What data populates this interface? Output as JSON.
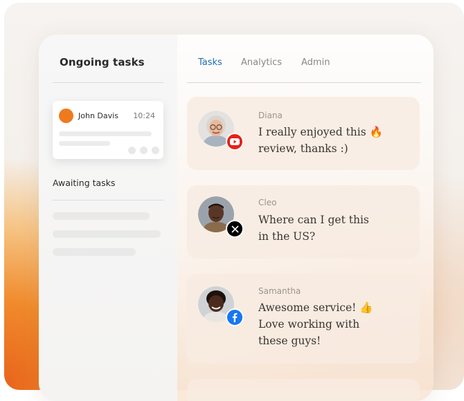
{
  "sidebar": {
    "title": "Ongoing tasks",
    "active_task": {
      "name": "John Davis",
      "time": "10:24"
    },
    "section_label": "Awaiting tasks"
  },
  "tabs": [
    {
      "label": "Tasks",
      "active": true
    },
    {
      "label": "Analytics",
      "active": false
    },
    {
      "label": "Admin",
      "active": false
    }
  ],
  "messages": [
    {
      "author": "Diana",
      "lines": [
        "I really enjoyed this 🔥",
        "review, thanks :)"
      ],
      "channel": "youtube-icon"
    },
    {
      "author": "Cleo",
      "lines": [
        "Where can I get this",
        "in the US?"
      ],
      "channel": "x-icon"
    },
    {
      "author": "Samantha",
      "lines": [
        "Awesome service! 👍",
        "Love working with",
        "these guys!"
      ],
      "channel": "facebook-icon"
    }
  ],
  "colors": {
    "accent_tab": "#1f6fb5",
    "youtube": "#e62117",
    "x": "#000000",
    "facebook": "#1877f2",
    "avatar_dot": "#ef7a1e"
  }
}
